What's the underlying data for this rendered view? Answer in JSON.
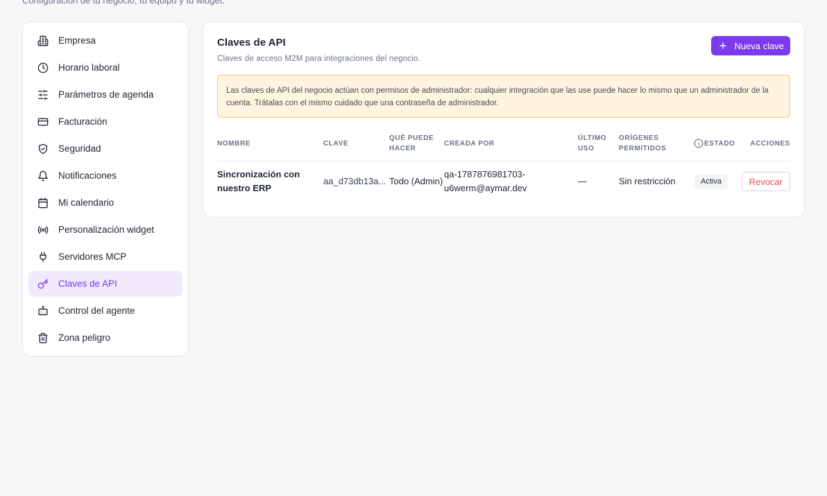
{
  "header": {
    "subtitle": "Configuración de tu negocio, tu equipo y tu widget."
  },
  "sidebar": {
    "items": [
      {
        "label": "Empresa",
        "icon": "building-icon"
      },
      {
        "label": "Horario laboral",
        "icon": "clock-icon"
      },
      {
        "label": "Parámetros de agenda",
        "icon": "sliders-icon"
      },
      {
        "label": "Facturación",
        "icon": "credit-card-icon"
      },
      {
        "label": "Seguridad",
        "icon": "shield-icon"
      },
      {
        "label": "Notificaciones",
        "icon": "bell-icon"
      },
      {
        "label": "Mi calendario",
        "icon": "calendar-icon"
      },
      {
        "label": "Personalización widget",
        "icon": "broadcast-icon"
      },
      {
        "label": "Servidores MCP",
        "icon": "plug-icon"
      },
      {
        "label": "Claves de API",
        "icon": "key-icon",
        "active": true
      },
      {
        "label": "Control del agente",
        "icon": "bot-icon"
      },
      {
        "label": "Zona peligro",
        "icon": "trash-icon"
      }
    ]
  },
  "panel": {
    "title": "Claves de API",
    "description": "Claves de acceso M2M para integraciones del negocio.",
    "new_key_label": "Nueva clave",
    "warning": "Las claves de API del negocio actúan con permisos de administrador: cualquier integración que las use puede hacer lo mismo que un administrador de la cuenta. Trátalas con el mismo cuidado que una contraseña de administrador."
  },
  "table": {
    "headers": {
      "name": "Nombre",
      "key": "Clave",
      "what": "Qué puede hacer",
      "created": "Creada por",
      "last_use": "Último uso",
      "origins": "Orígenes permitidos",
      "status": "Estado",
      "actions": "Acciones"
    },
    "rows": [
      {
        "name": "Sincronización con nuestro ERP",
        "key": "aa_d73db13a...",
        "what": "Todo (Admin)",
        "created": "qa-1787876981703-u6werm@aymar.dev",
        "last_use": "—",
        "origins": "Sin restricción",
        "status": "Activa",
        "action": "Revocar"
      }
    ]
  },
  "colors": {
    "accent": "#7c3aed",
    "warning_bg": "#fff4e0",
    "warning_border": "#f0c27a",
    "danger": "#e05252"
  }
}
